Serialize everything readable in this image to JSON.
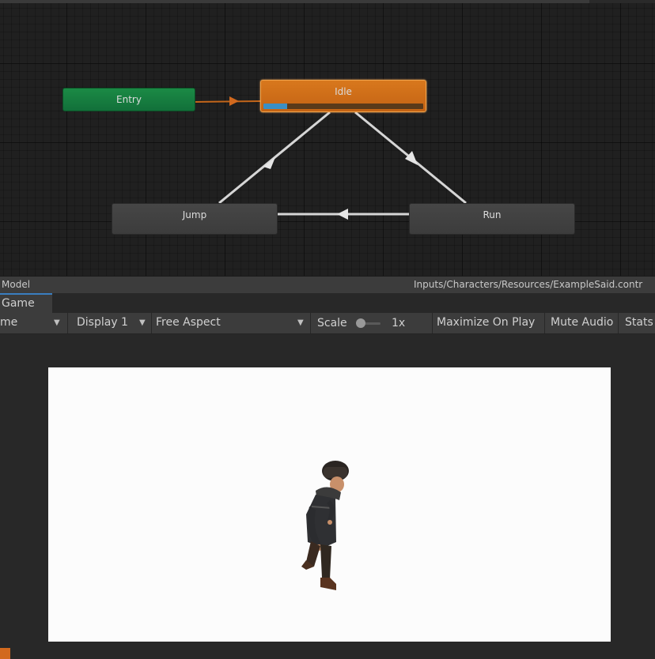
{
  "animator": {
    "states": {
      "entry": "Entry",
      "idle": "Idle",
      "jump": "Jump",
      "run": "Run"
    },
    "idle_progress": 0.15,
    "footer_left": "Model",
    "footer_path": "Inputs/Characters/Resources/ExampleSaid.contr"
  },
  "tab": {
    "game": "Game"
  },
  "toolbar": {
    "game_name": "me",
    "display": "Display 1",
    "aspect": "Free Aspect",
    "scale_label": "Scale",
    "scale_value": "1x",
    "maximize": "Maximize On Play",
    "mute": "Mute Audio",
    "stats": "Stats"
  },
  "colors": {
    "entry": "#1b8a45",
    "idle": "#d8781d",
    "state": "#464646",
    "progress": "#3a8fc4",
    "accent": "#d2691e"
  },
  "icons": {
    "dropdown": "caret-down-icon",
    "transition": "arrow-head-icon"
  }
}
